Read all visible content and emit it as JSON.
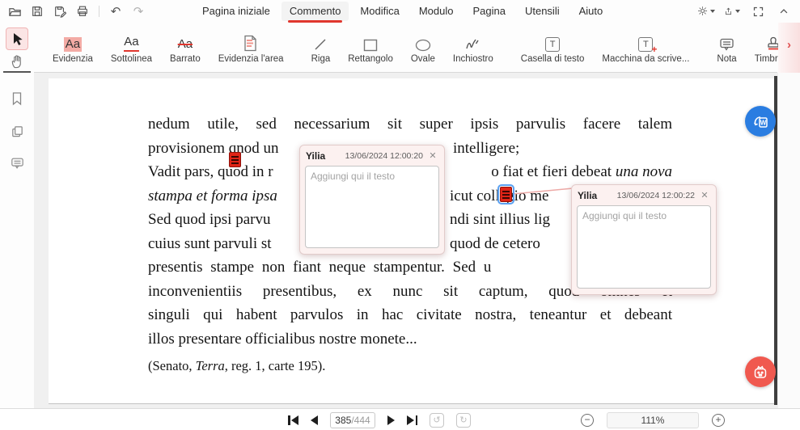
{
  "titlebar": {
    "tabs": [
      {
        "label": "Pagina iniziale",
        "active": false
      },
      {
        "label": "Commento",
        "active": true
      },
      {
        "label": "Modifica",
        "active": false
      },
      {
        "label": "Modulo",
        "active": false
      },
      {
        "label": "Pagina",
        "active": false
      },
      {
        "label": "Utensili",
        "active": false
      },
      {
        "label": "Aiuto",
        "active": false
      }
    ]
  },
  "toolbar": {
    "aa_glyph": "Aa",
    "t_glyph": "T",
    "items": [
      {
        "label": "Evidenzia",
        "icon": "highlight-icon"
      },
      {
        "label": "Sottolinea",
        "icon": "underline-icon"
      },
      {
        "label": "Barrato",
        "icon": "strikethrough-icon"
      },
      {
        "label": "Evidenzia l'area",
        "icon": "area-highlight-icon"
      },
      {
        "label": "Riga",
        "icon": "line-icon"
      },
      {
        "label": "Rettangolo",
        "icon": "rectangle-icon"
      },
      {
        "label": "Ovale",
        "icon": "oval-icon"
      },
      {
        "label": "Inchiostro",
        "icon": "ink-icon"
      },
      {
        "label": "Casella di testo",
        "icon": "textbox-icon"
      },
      {
        "label": "Macchina da scrive...",
        "icon": "typewriter-icon"
      },
      {
        "label": "Nota",
        "icon": "sticky-note-icon"
      },
      {
        "label": "Timbro",
        "icon": "stamp-icon"
      }
    ]
  },
  "document": {
    "line1": "nedum utile, sed necessarium sit super ipsis parvulis facere talem",
    "line2_left": "provisionem qnod un",
    "line2_right": "intelligere;",
    "line3_left": "Vadit pars, quod in r",
    "line3_right": "o fiat et fieri debeat ",
    "line3_right_italic": "una nova",
    "line4_left_italic": "stampa et forma ipsa",
    "line4_right": "icut collegio me",
    "line5_left": "Sed quod ipsi parvu",
    "line5_right": "ndi sint illius lig",
    "line6_left": "cuius sunt parvuli st",
    "line6_right": "quod de cetero",
    "line7": "presentis stampe non fiant neque stampentur. Sed u",
    "line8": "inconvenientiis presentibus, ex nunc sit captum, quod omnes et",
    "line9": "singuli qui habent parvulos in hac civitate nostra, teneantur et debeant",
    "line10": "illos presentare officialibus nostre monete...",
    "citation_pre": "(Senato, ",
    "citation_italic": "Terra",
    "citation_post": ", reg. 1, carte 195)."
  },
  "annotations": {
    "note1": {
      "author": "Yilia",
      "timestamp": "13/06/2024 12:00:20",
      "placeholder": "Aggiungi qui il testo"
    },
    "note2": {
      "author": "Yilia",
      "timestamp": "13/06/2024 12:00:22",
      "placeholder": "Aggiungi qui il testo"
    }
  },
  "statusbar": {
    "page_current": "385",
    "page_total": "/444",
    "zoom_level": "111%"
  },
  "colors": {
    "accent_red": "#e0372e",
    "note_red": "#e02417",
    "popup_bg": "#fcf1f0",
    "convert_button_blue": "#2a7de1",
    "assistant_button_red": "#f0594f"
  }
}
